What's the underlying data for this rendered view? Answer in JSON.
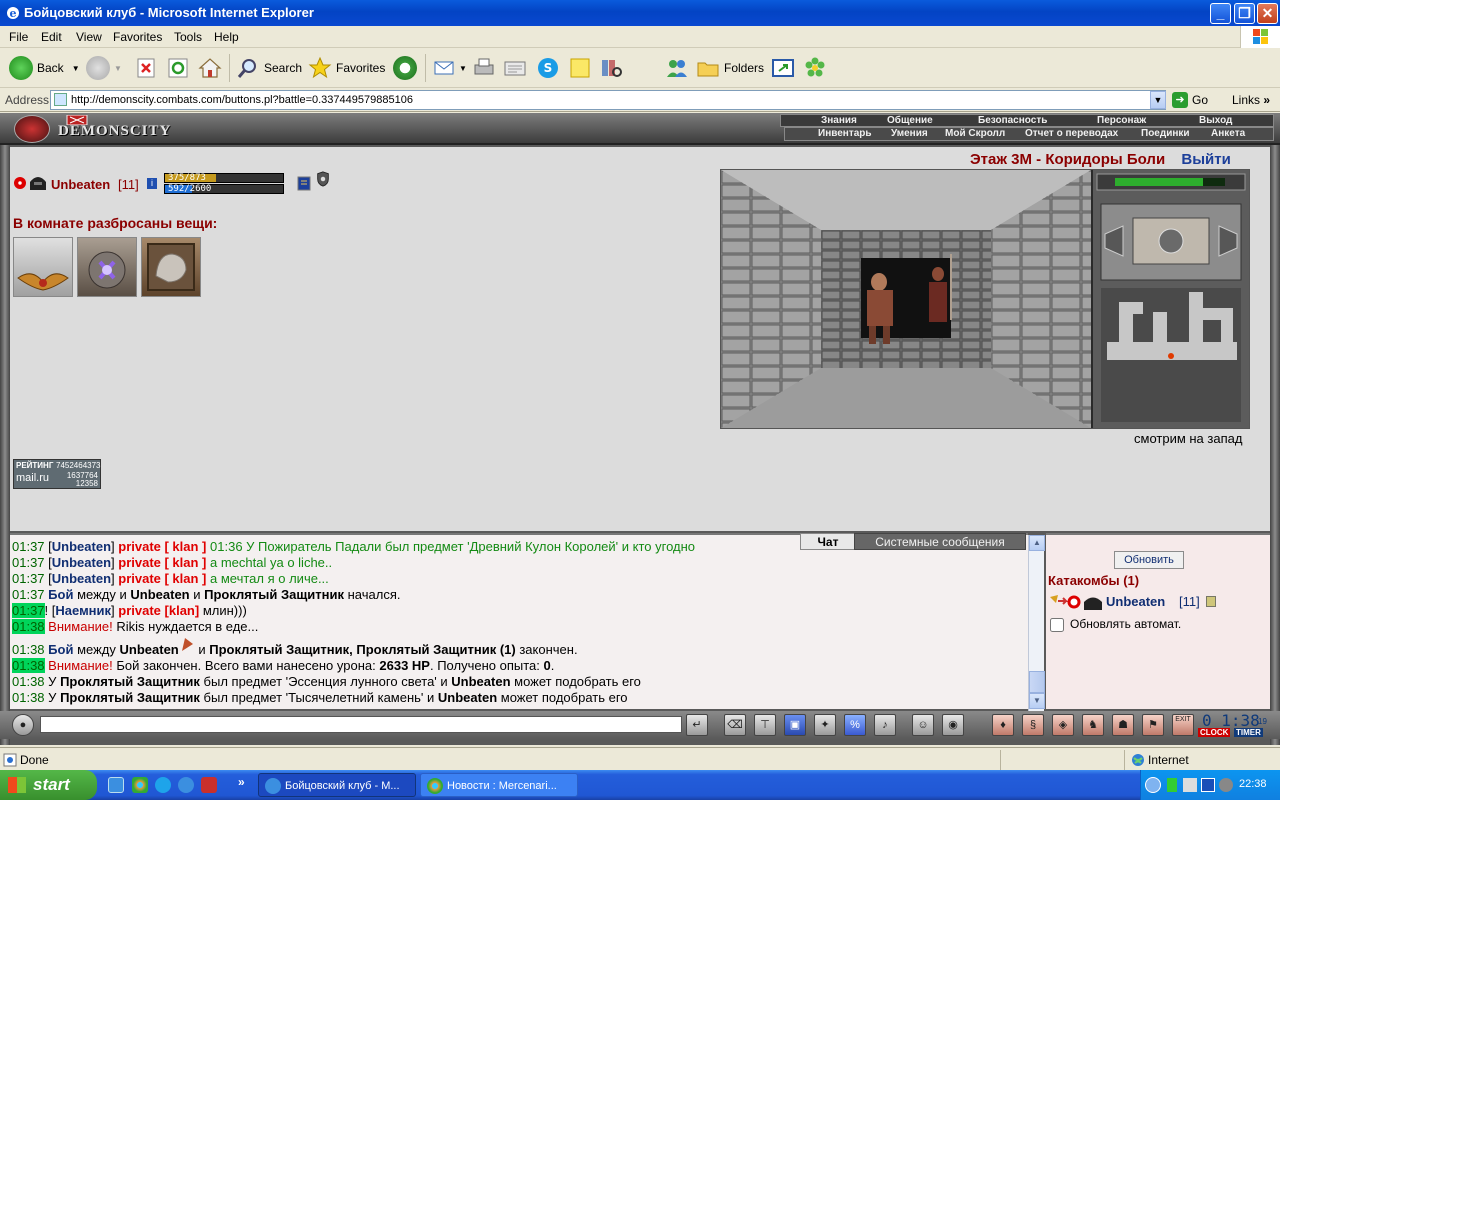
{
  "window": {
    "title": "Бойцовский клуб - Microsoft Internet Explorer",
    "min": "_",
    "max": "❐",
    "close": "✕"
  },
  "menu": [
    "File",
    "Edit",
    "View",
    "Favorites",
    "Tools",
    "Help"
  ],
  "toolbar": {
    "back": "Back",
    "search": "Search",
    "favorites": "Favorites",
    "folders": "Folders"
  },
  "address": {
    "label": "Address",
    "url": "http://demonscity.combats.com/buttons.pl?battle=0.337449579885106",
    "go": "Go",
    "links": "Links"
  },
  "game": {
    "logo": "DEMONSCITY",
    "nav_top": [
      "Знания",
      "Общение",
      "Безопасность",
      "Персонаж",
      "Выход"
    ],
    "nav_bottom": [
      "Инвентарь",
      "Умения",
      "Мой Скролл",
      "Отчет о переводах",
      "Поединки",
      "Анкета"
    ],
    "character": {
      "name": "Unbeaten",
      "level": "[11]",
      "info": "i",
      "hp_text": "375/873",
      "hp_fraction": 0.43,
      "mana_text": "592/2600",
      "mana_fraction": 0.23
    },
    "items_title": "В комнате разбросаны вещи:",
    "location": {
      "name": "Этаж 3М - Коридоры Боли",
      "exit": "Выйти",
      "direction": "смотрим на запад"
    },
    "rating": {
      "label": "РЕЙТИНГ",
      "n1": "7452464373",
      "brand": "mail.ru",
      "n2": "1637764",
      "n3": "12358"
    }
  },
  "chat": {
    "tab_chat": "Чат",
    "tab_system": "Системные сообщения",
    "lines": [
      {
        "ts": "01:37",
        "nick": "Unbeaten",
        "priv": "private [ klan ]",
        "msg": "01:36 У Пожиратель Падали был предмет 'Древний Кулон Королей' и кто угодно"
      },
      {
        "ts": "01:37",
        "nick": "Unbeaten",
        "priv": "private [ klan ]",
        "msg": "a mechtal ya o liche.."
      },
      {
        "ts": "01:37",
        "nick": "Unbeaten",
        "priv": "private [ klan ]",
        "msg": "а мечтал я о личе..."
      },
      {
        "ts": "01:37",
        "boy": "Бой",
        "t1": "между и",
        "p1": "Unbeaten",
        "t2": "и",
        "p2": "Проклятый Защитник",
        "t3": "начался."
      },
      {
        "ts": "01:37",
        "nick": "Наемник",
        "priv": "private [klan]",
        "msg": "млин)))"
      },
      {
        "ts": "01:38",
        "warn": "Внимание!",
        "msg": "Rikis нуждается в еде..."
      },
      {
        "ts": "01:38",
        "boy": "Бой",
        "t1": "между",
        "p1": "Unbeaten",
        "t2": "и",
        "p2": "Проклятый Защитник, Проклятый Защитник (1)",
        "t3": "закончен."
      },
      {
        "ts": "01:38",
        "warn": "Внимание!",
        "msg": "Бой закончен. Всего вами нанесено урона:",
        "val1": "2633 HP",
        "msg2": ". Получено опыта:",
        "val2": "0",
        "msg3": "."
      },
      {
        "ts": "01:38",
        "u": "У",
        "p1": "Проклятый Защитник",
        "t1": "был предмет 'Эссенция лунного света' и",
        "p2": "Unbeaten",
        "t2": "может подобрать его"
      },
      {
        "ts": "01:38",
        "u": "У",
        "p1": "Проклятый Защитник",
        "t1": "был предмет 'Тысячелетний камень' и",
        "p2": "Unbeaten",
        "t2": "может подобрать его"
      }
    ]
  },
  "online": {
    "refresh": "Обновить",
    "room": "Катакомбы (1)",
    "user_name": "Unbeaten",
    "user_level": "[11]",
    "auto_refresh": "Обновлять автомат."
  },
  "clock": {
    "time": "0 1:38",
    "sec": "19",
    "clock_label": "CLOCK",
    "timer_label": "TIMER",
    "exit_label": "EXIT"
  },
  "status": {
    "text": "Done",
    "zone": "Internet"
  },
  "taskbar": {
    "start": "start",
    "more": "»",
    "task1": "Бойцовский клуб - M...",
    "task2": "Новости : Mercenari...",
    "time": "22:38"
  }
}
